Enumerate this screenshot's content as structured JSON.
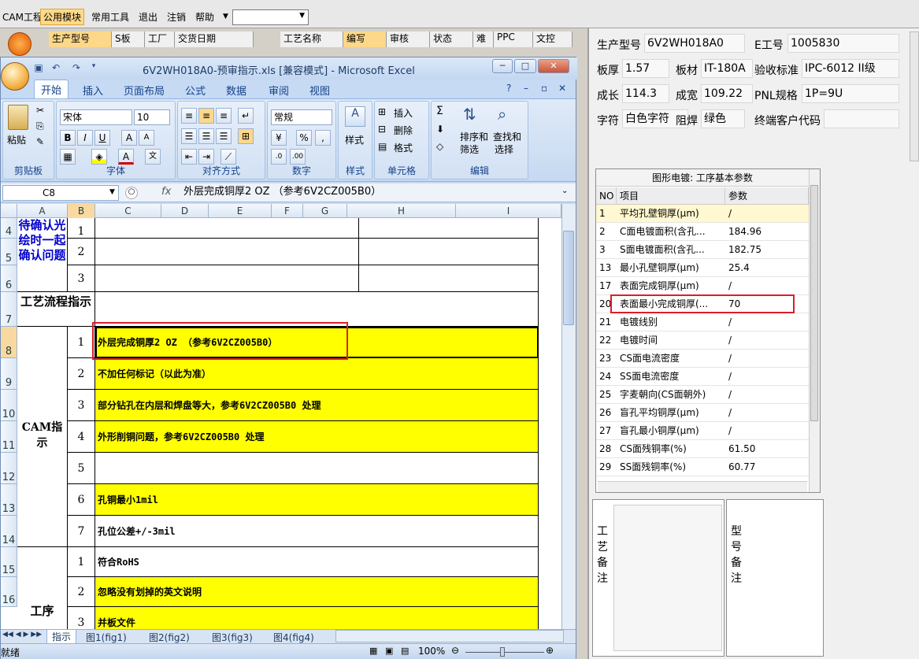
{
  "app_menu": {
    "items": [
      "CAM工程",
      "公用模块",
      "常用工具",
      "退出",
      "注销",
      "帮助"
    ],
    "active": "公用模块"
  },
  "bg_grid": {
    "left_headers": [
      "生产型号",
      "S板",
      "工厂",
      "交货日期"
    ],
    "right_headers": [
      "工艺名称",
      "编写",
      "审核",
      "状态",
      "难",
      "PPC",
      "文控"
    ]
  },
  "excel": {
    "title": "6V2WH018A0-预审指示.xls  [兼容模式] - Microsoft Excel",
    "tabs": [
      "开始",
      "插入",
      "页面布局",
      "公式",
      "数据",
      "审阅",
      "视图"
    ],
    "active_tab": "开始",
    "ribbon": {
      "clipboard": {
        "label": "剪贴板",
        "paste": "粘贴"
      },
      "font": {
        "label": "字体",
        "font_name": "宋体",
        "font_size": "10",
        "bold": "B",
        "italic": "I",
        "underline": "U",
        "grow": "A",
        "shrink": "A",
        "font_color": "A"
      },
      "align": {
        "label": "对齐方式"
      },
      "number": {
        "label": "数字",
        "format": "常规"
      },
      "styles": {
        "label": "样式"
      },
      "cells": {
        "label": "单元格",
        "insert": "插入",
        "delete": "删除",
        "format": "格式"
      },
      "editing": {
        "label": "编辑",
        "sigma": "Σ",
        "sort": "排序和",
        "filter": "筛选",
        "find": "查找和",
        "select": "选择"
      }
    },
    "name_box": "C8",
    "fx": "fx",
    "formula": "外层完成铜厚2 OZ  （参考6V2CZ005B0）",
    "columns": [
      "A",
      "B",
      "C",
      "D",
      "E",
      "F",
      "G",
      "H",
      "I"
    ],
    "rows": {
      "confirm_label": "待确认光绘时一起确认问题",
      "confirm_nums": [
        "1",
        "2",
        "3"
      ],
      "flow_label": "工艺流程指示",
      "cam_label": "CAM指示",
      "cam_items": [
        {
          "n": "1",
          "text": "外层完成铜厚2 OZ  （参考6V2CZ005B0）",
          "yellow": true
        },
        {
          "n": "2",
          "text": "不加任何标记（以此为准）",
          "yellow": true
        },
        {
          "n": "3",
          "text": "部分钻孔在内层和焊盘等大，参考6V2CZ005B0 处理",
          "yellow": true
        },
        {
          "n": "4",
          "text": "外形削铜问题，参考6V2CZ005B0 处理",
          "yellow": true
        },
        {
          "n": "5",
          "text": "",
          "yellow": false
        },
        {
          "n": "6",
          "text": "孔铜最小1mil",
          "yellow": true
        },
        {
          "n": "7",
          "text": "孔位公差+/-3mil",
          "yellow": false
        }
      ],
      "proc_label": "工序",
      "proc_items": [
        {
          "n": "1",
          "text": "符合RoHS",
          "yellow": false
        },
        {
          "n": "2",
          "text": "忽略没有划掉的英文说明",
          "yellow": true
        },
        {
          "n": "3",
          "text": "并板文件",
          "yellow": true
        }
      ],
      "row_numbers": [
        "4",
        "5",
        "6",
        "7",
        "8",
        "9",
        "10",
        "11",
        "12",
        "13",
        "14",
        "15",
        "16"
      ]
    },
    "sheet_tabs": [
      "指示",
      "图1(fig1)",
      "图2(fig2)",
      "图3(fig3)",
      "图4(fig4)"
    ],
    "active_sheet": "指示",
    "status": "就绪",
    "zoom": "100%"
  },
  "info_panel": {
    "fields": [
      {
        "label": "生产型号",
        "value": "6V2WH018A0"
      },
      {
        "label": "E工号",
        "value": "1005830"
      },
      {
        "label": "板厚",
        "value": "1.57"
      },
      {
        "label": "板材",
        "value": "IT-180A"
      },
      {
        "label": "验收标准",
        "value": "IPC-6012 II级"
      },
      {
        "label": "成长",
        "value": "114.3"
      },
      {
        "label": "成宽",
        "value": "109.22"
      },
      {
        "label": "PNL规格",
        "value": "1P=9U"
      },
      {
        "label": "字符",
        "value": "白色字符"
      },
      {
        "label": "阻焊",
        "value": "绿色"
      },
      {
        "label": "终端客户代码",
        "value": ""
      }
    ]
  },
  "param_table": {
    "title": "图形电镀: 工序基本参数",
    "headers": [
      "NO",
      "项目",
      "参数"
    ],
    "rows": [
      {
        "no": "1",
        "item": "平均孔壁铜厚(μm)",
        "val": "/"
      },
      {
        "no": "2",
        "item": "C面电镀面积(含孔...",
        "val": "184.96"
      },
      {
        "no": "3",
        "item": "S面电镀面积(含孔...",
        "val": "182.75"
      },
      {
        "no": "13",
        "item": "最小孔壁铜厚(μm)",
        "val": "25.4"
      },
      {
        "no": "17",
        "item": "表面完成铜厚(μm)",
        "val": "/"
      },
      {
        "no": "20",
        "item": "表面最小完成铜厚(...",
        "val": "70"
      },
      {
        "no": "21",
        "item": "电镀线别",
        "val": "/"
      },
      {
        "no": "22",
        "item": "电镀时间",
        "val": "/"
      },
      {
        "no": "23",
        "item": "CS面电流密度",
        "val": "/"
      },
      {
        "no": "24",
        "item": "SS面电流密度",
        "val": "/"
      },
      {
        "no": "25",
        "item": "字麦朝向(CS面朝外)",
        "val": "/"
      },
      {
        "no": "26",
        "item": "盲孔平均铜厚(μm)",
        "val": "/"
      },
      {
        "no": "27",
        "item": "盲孔最小铜厚(μm)",
        "val": "/"
      },
      {
        "no": "28",
        "item": "CS面残铜率(%)",
        "val": "61.50"
      },
      {
        "no": "29",
        "item": "SS面残铜率(%)",
        "val": "60.77"
      }
    ]
  },
  "memo": {
    "process_label": "工艺备注",
    "model_label": "型号备注"
  }
}
